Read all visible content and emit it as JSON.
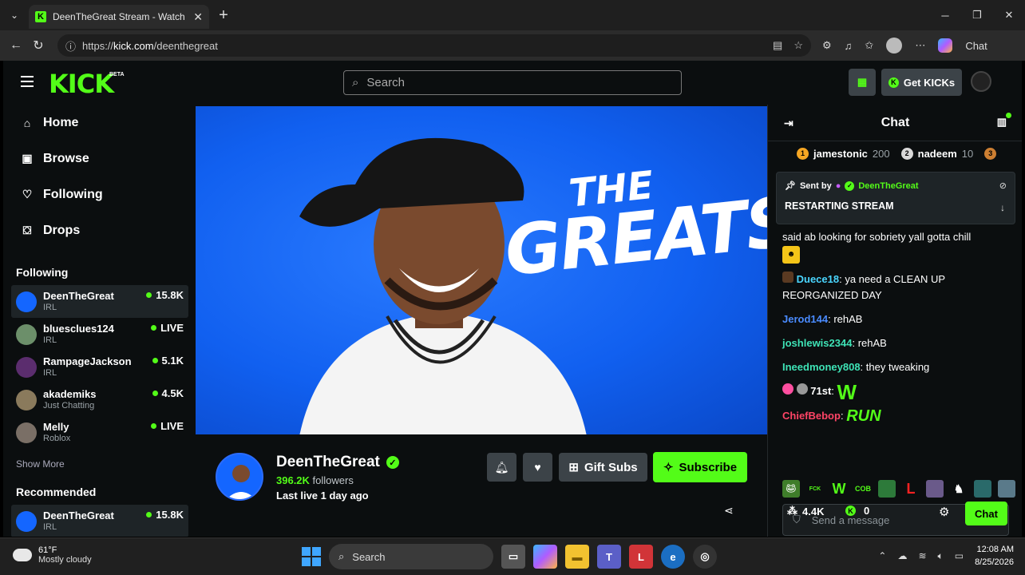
{
  "browser": {
    "tab_title": "DeenTheGreat Stream - Watch Live",
    "url_prefix": "https://",
    "url_host": "kick.com",
    "url_path": "/deenthegreat",
    "copilot_label": "Chat"
  },
  "header": {
    "logo": "KICK",
    "logo_badge": "BETA",
    "search_placeholder": "Search",
    "get_kicks_label": "Get KICKs"
  },
  "sidebar": {
    "nav": [
      {
        "label": "Home",
        "icon": "home-icon"
      },
      {
        "label": "Browse",
        "icon": "browse-icon"
      },
      {
        "label": "Following",
        "icon": "heart-icon"
      },
      {
        "label": "Drops",
        "icon": "drops-icon"
      }
    ],
    "following_heading": "Following",
    "following": [
      {
        "name": "DeenTheGreat",
        "category": "IRL",
        "count": "15.8K",
        "avatar_color": "#1466ff"
      },
      {
        "name": "bluesclues124",
        "category": "IRL",
        "count": "LIVE",
        "avatar_color": "#6c8f6a"
      },
      {
        "name": "RampageJackson",
        "category": "IRL",
        "count": "5.1K",
        "avatar_color": "#5b2d6e"
      },
      {
        "name": "akademiks",
        "category": "Just Chatting",
        "count": "4.5K",
        "avatar_color": "#8a7a5c"
      },
      {
        "name": "Melly",
        "category": "Roblox",
        "count": "LIVE",
        "avatar_color": "#7a6f66"
      }
    ],
    "show_more": "Show More",
    "recommended_heading": "Recommended",
    "recommended": [
      {
        "name": "DeenTheGreat",
        "category": "IRL",
        "count": "15.8K",
        "avatar_color": "#1466ff"
      }
    ]
  },
  "player": {
    "thumbnail_text_line1": "THE",
    "thumbnail_text_line2": "GREATS"
  },
  "channel": {
    "name": "DeenTheGreat",
    "followers_count": "396.2K",
    "followers_label": "followers",
    "last_live": "Last live 1 day ago",
    "gift_subs_label": "Gift Subs",
    "subscribe_label": "Subscribe"
  },
  "chat": {
    "title": "Chat",
    "leaderboard": [
      {
        "rank": "1",
        "name": "jamestonic",
        "points": "200",
        "color": "#f5a623"
      },
      {
        "rank": "2",
        "name": "nadeem",
        "points": "10",
        "color": "#d9d9d9"
      },
      {
        "rank": "3",
        "name": "",
        "points": "",
        "color": "#cd7f32"
      }
    ],
    "pinned": {
      "sent_by_label": "Sent by",
      "sender": "DeenTheGreat",
      "message": "RESTARTING STREAM"
    },
    "messages": [
      {
        "user": "",
        "user_color": "#ffffff",
        "text": "said ab looking for sobriety yall gotta chill"
      },
      {
        "user": "Duece18",
        "user_color": "#4ad6ff",
        "text": "ya need a CLEAN UP REORGANIZED DAY"
      },
      {
        "user": "Jerod144",
        "user_color": "#4a8bff",
        "text": "rehAB"
      },
      {
        "user": "joshlewis2344",
        "user_color": "#3ee3b6",
        "text": "rehAB"
      },
      {
        "user": "Ineedmoney808",
        "user_color": "#3ee3b6",
        "text": "they tweaking"
      },
      {
        "user": "71st",
        "user_color": "#ffffff",
        "text": "W"
      },
      {
        "user": "ChiefBebop",
        "user_color": "#ff4466",
        "text": "RUN"
      }
    ],
    "input_placeholder": "Send a message",
    "viewers": "4.4K",
    "kicks_balance": "0",
    "chat_button": "Chat"
  },
  "taskbar": {
    "temp": "61°F",
    "condition": "Mostly cloudy",
    "search_label": "Search",
    "time": "12:08 AM",
    "date": "8/25/2026"
  }
}
